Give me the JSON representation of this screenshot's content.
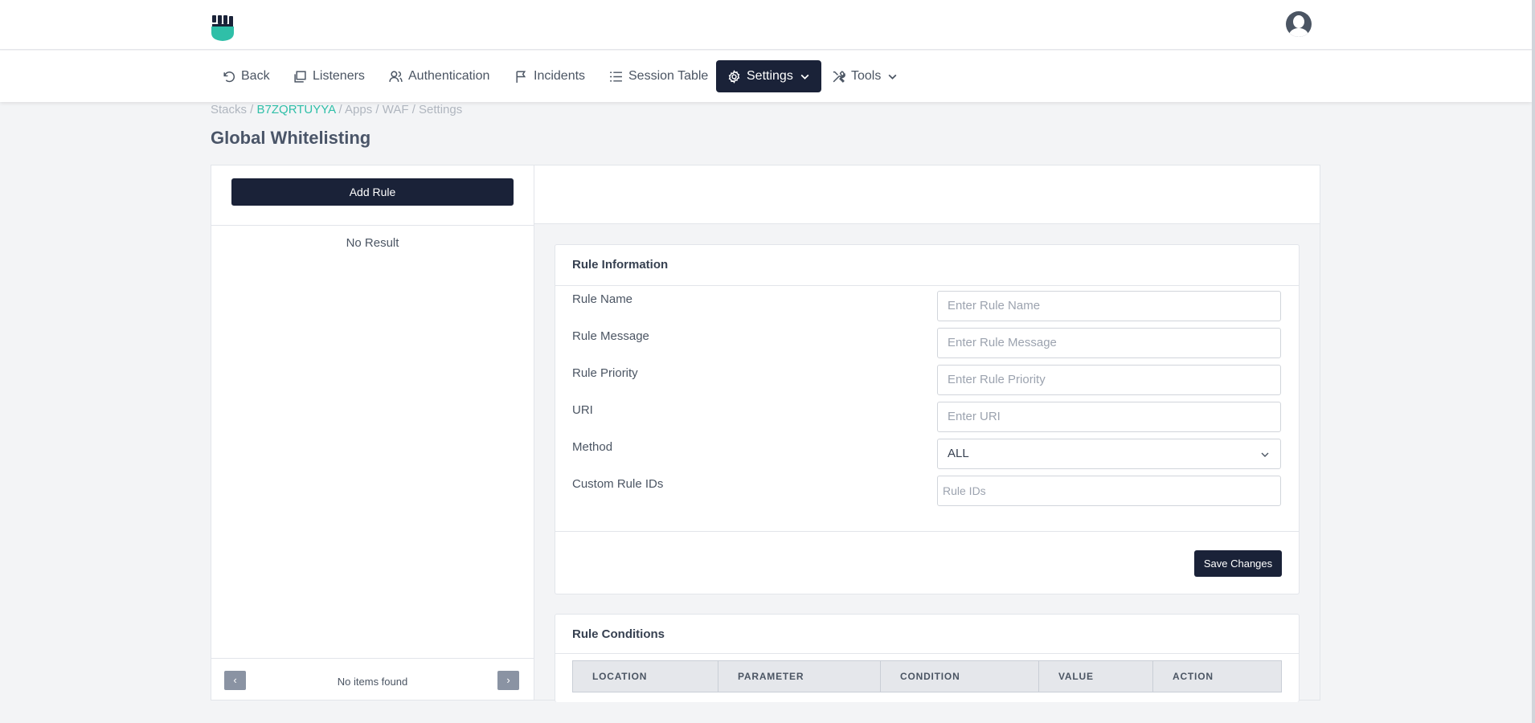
{
  "header": {
    "logo_icon": "fist-shield-logo",
    "avatar_icon": "user-avatar-icon"
  },
  "nav": {
    "items": [
      {
        "label": "Back",
        "icon": "undo-icon"
      },
      {
        "label": "Listeners",
        "icon": "windows-icon"
      },
      {
        "label": "Authentication",
        "icon": "users-icon"
      },
      {
        "label": "Incidents",
        "icon": "flag-icon"
      },
      {
        "label": "Session Table",
        "icon": "list-icon"
      },
      {
        "label": "Settings",
        "icon": "gear-icon",
        "active": true
      },
      {
        "label": "Tools",
        "icon": "tools-icon"
      }
    ]
  },
  "breadcrumb": {
    "stacks": "Stacks",
    "sep": " / ",
    "stack_id": "B7ZQRTUYYA",
    "apps": "Apps",
    "waf": "WAF",
    "settings": "Settings"
  },
  "page": {
    "title": "Global Whitelisting"
  },
  "left_panel": {
    "add_rule_label": "Add Rule",
    "empty_text": "No Result",
    "footer_text": "No items found",
    "prev_symbol": "‹",
    "next_symbol": "›"
  },
  "rule_info": {
    "title": "Rule Information",
    "fields": [
      {
        "label": "Rule Name",
        "placeholder": "Enter Rule Name"
      },
      {
        "label": "Rule Message",
        "placeholder": "Enter Rule Message"
      },
      {
        "label": "Rule Priority",
        "placeholder": "Enter Rule Priority"
      },
      {
        "label": "URI",
        "placeholder": "Enter URI"
      },
      {
        "label": "Method",
        "value": "ALL"
      },
      {
        "label": "Custom Rule IDs",
        "placeholder": "Rule IDs"
      }
    ],
    "save_label": "Save Changes"
  },
  "rule_conditions": {
    "title": "Rule Conditions",
    "columns": [
      "LOCATION",
      "PARAMETER",
      "CONDITION",
      "VALUE",
      "ACTION"
    ]
  },
  "colors": {
    "primary": "#1a2238",
    "link": "#2fbfa8",
    "logo": "#2fbfa8"
  }
}
